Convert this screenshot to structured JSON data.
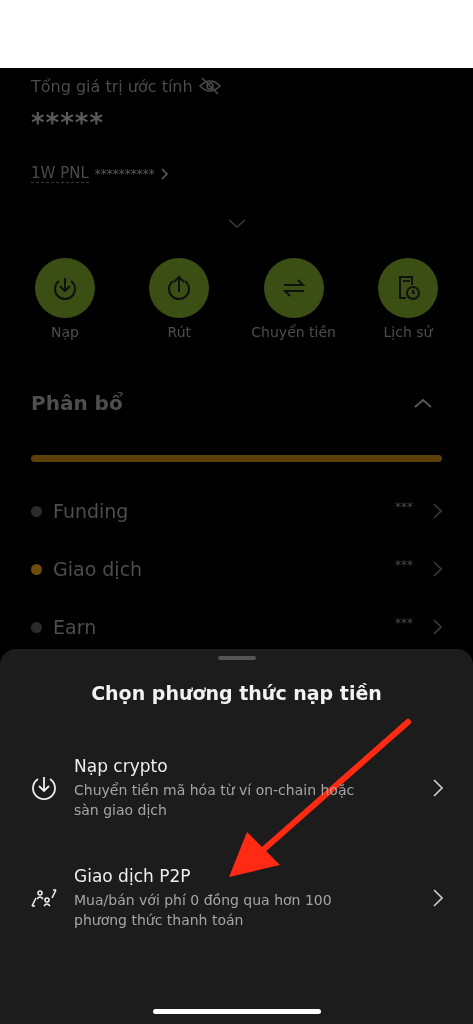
{
  "summary": {
    "label": "Tổng giá trị ước tính",
    "value": "*****",
    "pnl_label": "1W PNL",
    "pnl_value": "**********"
  },
  "actions": [
    {
      "label": "Nạp",
      "kind": "deposit"
    },
    {
      "label": "Rút",
      "kind": "withdraw"
    },
    {
      "label": "Chuyển tiền",
      "kind": "transfer"
    },
    {
      "label": "Lịch sử",
      "kind": "history"
    }
  ],
  "allocation": {
    "title": "Phân bổ",
    "items": [
      {
        "name": "Funding",
        "value": "***",
        "color": "#2b2b2b"
      },
      {
        "name": "Giao dịch",
        "value": "***",
        "color": "#6e4c0c"
      },
      {
        "name": "Earn",
        "value": "***",
        "color": "#2b2b2b"
      }
    ]
  },
  "sheet": {
    "title": "Chọn phương thức nạp tiền",
    "options": [
      {
        "title": "Nạp crypto",
        "description": "Chuyển tiền mã hóa từ ví on-chain hoặc sàn giao dịch",
        "kind": "crypto"
      },
      {
        "title": "Giao dịch P2P",
        "description": "Mua/bán với phí 0 đồng qua hơn 100 phương thức thanh toán",
        "kind": "p2p"
      }
    ]
  }
}
